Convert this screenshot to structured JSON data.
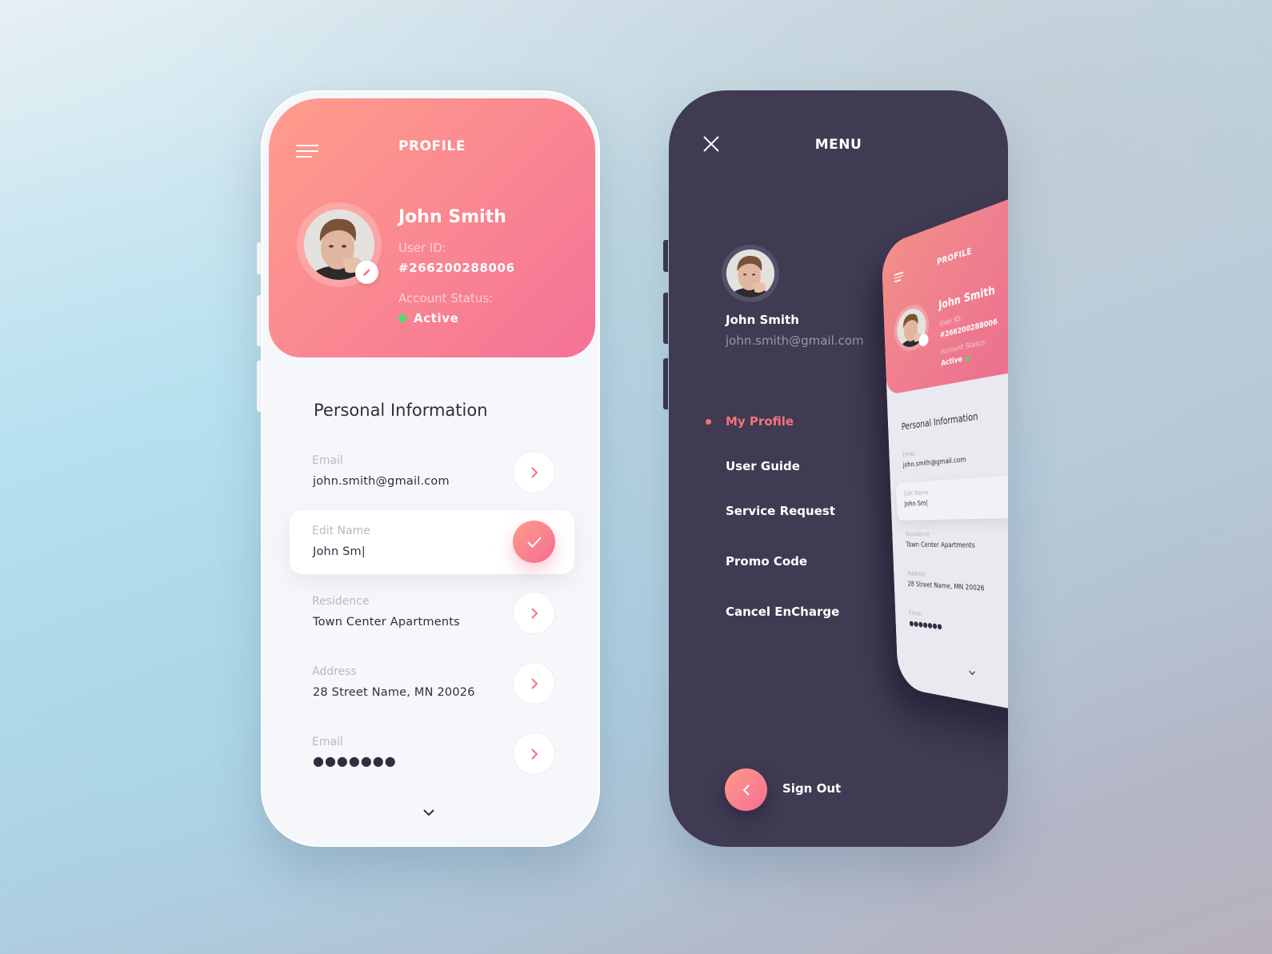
{
  "profile_screen": {
    "title": "PROFILE",
    "user": {
      "name": "John Smith",
      "user_id_label": "User ID:",
      "user_id": "#266200288006",
      "status_label": "Account Status:",
      "status": "Active"
    },
    "section_title": "Personal Information",
    "fields": [
      {
        "label": "Email",
        "value": "john.smith@gmail.com",
        "action": "chevron-right"
      },
      {
        "label": "Edit Name",
        "value": "John Sm|",
        "action": "check",
        "editing": true
      },
      {
        "label": "Residence",
        "value": "Town Center Apartments",
        "action": "chevron-right"
      },
      {
        "label": "Address",
        "value": "28 Street Name, MN 20026",
        "action": "chevron-right"
      },
      {
        "label": "Email",
        "value": "●●●●●●●",
        "action": "chevron-right"
      }
    ]
  },
  "menu_screen": {
    "title": "MENU",
    "user": {
      "name": "John Smith",
      "email": "john.smith@gmail.com"
    },
    "items": [
      {
        "label": "My Profile",
        "active": true
      },
      {
        "label": "User Guide",
        "active": false
      },
      {
        "label": "Service Request",
        "active": false
      },
      {
        "label": "Promo Code",
        "active": false
      },
      {
        "label": "Cancel EnCharge",
        "active": false
      }
    ],
    "sign_out_label": "Sign Out"
  },
  "mini_preview": {
    "title": "PROFILE",
    "name": "John Smith",
    "user_id_label": "User ID:",
    "user_id": "#266200288006",
    "status_label": "Account Status:",
    "status": "Active",
    "section_title": "Personal Information",
    "fields": [
      {
        "label": "Email",
        "value": "john.smith@gmail.com"
      },
      {
        "label": "Edit Name",
        "value": "John Sm|"
      },
      {
        "label": "Residence",
        "value": "Town Center Apartments"
      },
      {
        "label": "Address",
        "value": "28 Street Name, MN 20026"
      },
      {
        "label": "Email",
        "value": "●●●●●●●"
      }
    ]
  },
  "colors": {
    "accent_pink": "#f4737a",
    "gradient_start": "#ff9d8b",
    "gradient_end": "#f47197",
    "dark_bg": "#403a52",
    "status_green": "#46e169",
    "text_dark": "#2f2e41",
    "label_gray": "#b6b9c6"
  }
}
